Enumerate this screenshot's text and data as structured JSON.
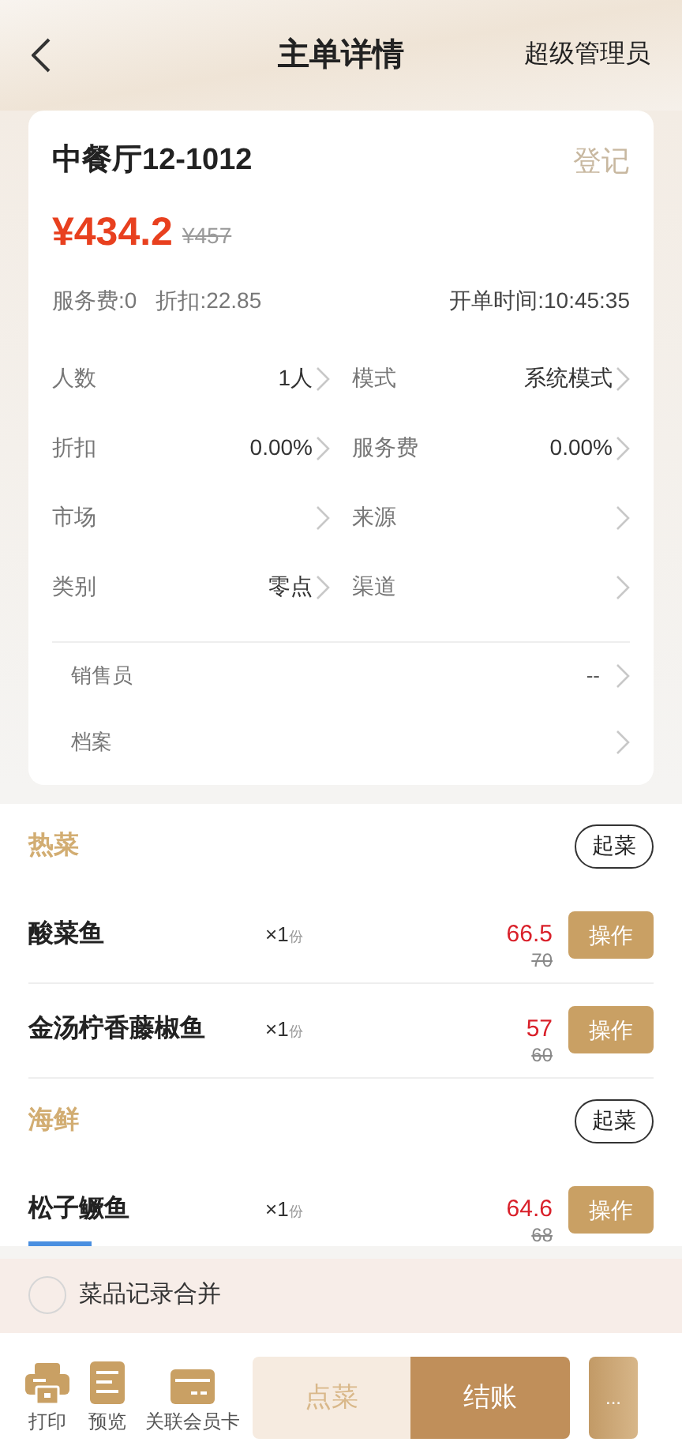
{
  "header": {
    "title": "主单详情",
    "role": "超级管理员"
  },
  "order": {
    "table_name": "中餐厅12-1012",
    "register": "登记",
    "price": "¥434.2",
    "original_price": "¥457",
    "service_fee": "服务费:0",
    "discount": "折扣:22.85",
    "open_time": "开单时间:10:45:35",
    "fields": [
      {
        "label": "人数",
        "value": "1人"
      },
      {
        "label": "模式",
        "value": "系统模式"
      },
      {
        "label": "折扣",
        "value": "0.00%"
      },
      {
        "label": "服务费",
        "value": "0.00%"
      },
      {
        "label": "市场"
      },
      {
        "label": "来源"
      },
      {
        "label": "类别",
        "value": "零点"
      },
      {
        "label": "渠道"
      }
    ],
    "extra_fields": [
      {
        "label": "销售员",
        "value": "--"
      },
      {
        "label": "档案"
      }
    ]
  },
  "categories": [
    {
      "name": "热菜",
      "action": "起菜",
      "dishes": [
        {
          "name": "酸菜鱼",
          "qty": "×1",
          "unit": "份",
          "price": "66.5",
          "original_price": "70",
          "action": "操作"
        },
        {
          "name": "金汤柠香藤椒鱼",
          "qty": "×1",
          "unit": "份",
          "price": "57",
          "original_price": "60",
          "action": "操作"
        }
      ]
    },
    {
      "name": "海鲜",
      "action": "起菜",
      "dishes": [
        {
          "name": "松子鳜鱼",
          "qty": "×1",
          "unit": "份",
          "price": "64.6",
          "original_price": "68",
          "action": "操作"
        }
      ]
    }
  ],
  "merge": {
    "label": "菜品记录合并",
    "checked": false
  },
  "toolbar": [
    {
      "kind": "print",
      "label": "打印"
    },
    {
      "kind": "preview",
      "label": "预览"
    },
    {
      "kind": "card",
      "label": "关联会员卡"
    }
  ],
  "actions": {
    "order": "点菜",
    "checkout": "结账",
    "more": "..."
  }
}
